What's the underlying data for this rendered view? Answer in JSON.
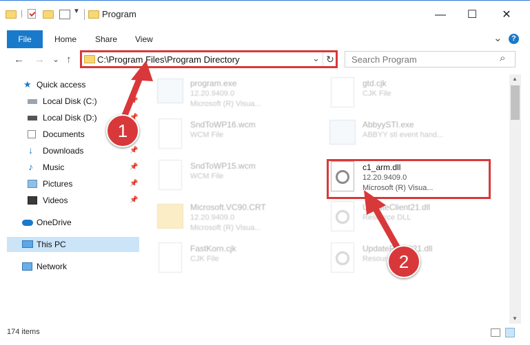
{
  "window": {
    "title": "Program",
    "qat_separator": "|",
    "min_glyph": "—",
    "max_glyph": "☐",
    "close_glyph": "✕"
  },
  "ribbon": {
    "tabs": [
      "File",
      "Home",
      "Share",
      "View"
    ],
    "collapse_glyph": "⌄",
    "help_glyph": "?"
  },
  "nav": {
    "back": "←",
    "forward": "→",
    "recent": "⌄",
    "up": "↑",
    "address": "C:\\Program Files\\Program Directory",
    "address_dropdown": "⌄",
    "refresh": "↻",
    "search_placeholder": "Search Program",
    "search_glyph": "⌕"
  },
  "sidebar": {
    "items": [
      {
        "label": "Quick access",
        "icon": "star-icon",
        "pinned": false
      },
      {
        "label": "Local Disk (C:)",
        "icon": "drive-icon",
        "pinned": true
      },
      {
        "label": "Local Disk (D:)",
        "icon": "drive-icon",
        "pinned": true
      },
      {
        "label": "Documents",
        "icon": "documents-icon",
        "pinned": true
      },
      {
        "label": "Downloads",
        "icon": "downloads-icon",
        "pinned": true
      },
      {
        "label": "Music",
        "icon": "music-icon",
        "pinned": true
      },
      {
        "label": "Pictures",
        "icon": "pictures-icon",
        "pinned": true
      },
      {
        "label": "Videos",
        "icon": "videos-icon",
        "pinned": true
      },
      {
        "label": "OneDrive",
        "icon": "onedrive-icon",
        "pinned": false
      },
      {
        "label": "This PC",
        "icon": "pc-icon",
        "pinned": false
      },
      {
        "label": "Network",
        "icon": "network-icon",
        "pinned": false
      }
    ],
    "pin_glyph": "📌"
  },
  "files": [
    {
      "name": "program.exe",
      "line2": "12.20.9409.0",
      "line3": "Microsoft (R) Visua...",
      "icon": "exe-icon"
    },
    {
      "name": "gtd.cjk",
      "line2": "CJK File",
      "line3": "",
      "icon": "file-icon"
    },
    {
      "name": "SndToWP16.wcm",
      "line2": "WCM File",
      "line3": "",
      "icon": "file-icon"
    },
    {
      "name": "AbbyySTI.exe",
      "line2": "ABBYY sti event hand...",
      "line3": "",
      "icon": "exe-icon"
    },
    {
      "name": "SndToWP15.wcm",
      "line2": "WCM File",
      "line3": "",
      "icon": "file-icon"
    },
    {
      "name": "c1_arm.dll",
      "line2": "12.20.9409.0",
      "line3": "Microsoft (R) Visua...",
      "icon": "dll-icon"
    },
    {
      "name": "Microsoft.VC90.CRT",
      "line2": "12.20.9409.0",
      "line3": "Microsoft (R) Visua...",
      "icon": "folder-icon"
    },
    {
      "name": "UpdateClient21.dll",
      "line2": "Resource DLL",
      "line3": "",
      "icon": "dll-icon"
    },
    {
      "name": "FastKorn.cjk",
      "line2": "CJK File",
      "line3": "",
      "icon": "file-icon"
    },
    {
      "name": "UpdateResult21.dll",
      "line2": "Resource DLL",
      "line3": "",
      "icon": "dll-icon"
    }
  ],
  "status": {
    "items": "174 items"
  },
  "callouts": {
    "one": "1",
    "two": "2"
  },
  "colors": {
    "accent": "#1979ca",
    "highlight": "#d8383a",
    "selected": "#cce4f7"
  }
}
